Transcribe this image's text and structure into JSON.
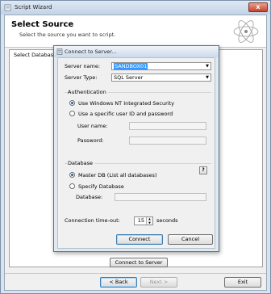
{
  "window": {
    "title": "Script Wizard",
    "close_glyph": "x"
  },
  "header": {
    "title": "Select Source",
    "subtitle": "Select the source you want to script."
  },
  "main": {
    "select_database_label": "Select Database",
    "connect_to_server_button": "Connect to Server"
  },
  "footer": {
    "back_button": "< Back",
    "next_button": "Next >",
    "exit_button": "Exit"
  },
  "dialog": {
    "title": "Connect to Server...",
    "server_name_label": "Server name:",
    "server_name_value": "SANDBOX01",
    "server_type_label": "Server Type:",
    "server_type_value": "SQL Server",
    "authentication": {
      "group_title": "Authentication",
      "windows_auth_label": "Use Windows NT Integrated Security",
      "specific_user_label": "Use a specific user ID and password",
      "user_name_label": "User name:",
      "password_label": "Password:",
      "selected": "windows"
    },
    "database": {
      "group_title": "Database",
      "master_db_label": "Master DB (List all databases)",
      "specify_db_label": "Specify Database",
      "database_label": "Database:",
      "help_glyph": "?",
      "selected": "master"
    },
    "timeout_label": "Connection time-out:",
    "timeout_value": "15",
    "timeout_unit": "seconds",
    "connect_button": "Connect",
    "cancel_button": "Cancel"
  },
  "colors": {
    "selection": "#3399ff",
    "radio_dot": "#1c5fa8",
    "close_button": "#c8442a"
  }
}
